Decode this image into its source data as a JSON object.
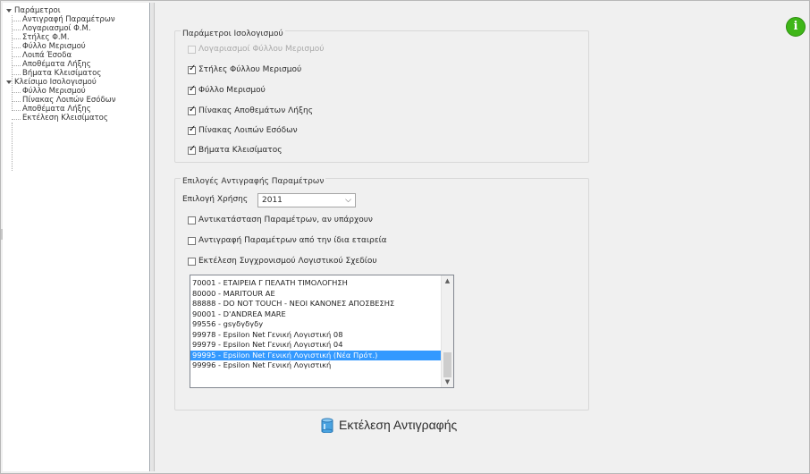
{
  "tree": {
    "nodes": [
      {
        "label": "Παράμετροι",
        "level": 0,
        "expander": true
      },
      {
        "label": "Αντιγραφή Παραμέτρων",
        "level": 1
      },
      {
        "label": "Λογαριασμοί Φ.Μ.",
        "level": 1
      },
      {
        "label": "Στήλες Φ.Μ.",
        "level": 1
      },
      {
        "label": "Φύλλο Μερισμού",
        "level": 1
      },
      {
        "label": "Λοιπά Έσοδα",
        "level": 1
      },
      {
        "label": "Αποθέματα Λήξης",
        "level": 1
      },
      {
        "label": "Βήματα Κλεισίματος",
        "level": 1
      },
      {
        "label": "Κλείσιμο Ισολογισμού",
        "level": 0,
        "expander": true
      },
      {
        "label": "Φύλλο Μερισμού",
        "level": 1
      },
      {
        "label": "Πίνακας Λοιπών Εσόδων",
        "level": 1
      },
      {
        "label": "Αποθέματα Λήξης",
        "level": 1
      },
      {
        "label": "Εκτέλεση Κλεισίματος",
        "level": 1
      }
    ]
  },
  "params_group": {
    "title": "Παράμετροι Ισολογισμού",
    "options": [
      {
        "label": "Λογαριασμοί Φύλλου Μερισμού",
        "checked": false,
        "disabled": true
      },
      {
        "label": "Στήλες Φύλλου Μερισμού",
        "checked": true,
        "disabled": false
      },
      {
        "label": "Φύλλο Μερισμού",
        "checked": true,
        "disabled": false
      },
      {
        "label": "Πίνακας Αποθεμάτων Λήξης",
        "checked": true,
        "disabled": false
      },
      {
        "label": "Πίνακας Λοιπών Εσόδων",
        "checked": true,
        "disabled": false
      },
      {
        "label": "Βήματα Κλεισίματος",
        "checked": true,
        "disabled": false
      }
    ]
  },
  "copy_group": {
    "title": "Επιλογές Αντιγραφής Παραμέτρων",
    "year_label": "Επιλογή Χρήσης",
    "year_value": "2011",
    "options": [
      {
        "label": "Αντικατάσταση Παραμέτρων, αν υπάρχουν",
        "checked": false
      },
      {
        "label": "Αντιγραφή Παραμέτρων από την ίδια εταιρεία",
        "checked": false
      },
      {
        "label": "Εκτέλεση Συγχρονισμού Λογιστικού Σχεδίου",
        "checked": false
      }
    ],
    "companies": [
      {
        "label": "70001 - ΕΤΑΙΡΕΙΑ Γ ΠΕΛΑΤΗ ΤΙΜΟΛΟΓΗΣΗ",
        "selected": false
      },
      {
        "label": "80000 - MARITOUR AE",
        "selected": false
      },
      {
        "label": "88888 - DO NOT TOUCH - ΝΕΟΙ ΚΑΝΟΝΕΣ ΑΠΟΣΒΕΣΗΣ",
        "selected": false
      },
      {
        "label": "90001 - D'ANDREA MARE",
        "selected": false
      },
      {
        "label": "99556 - gsγδγδγδy",
        "selected": false
      },
      {
        "label": "99978 - Epsilon Net Γενική Λογιστική 08",
        "selected": false
      },
      {
        "label": "99979 - Epsilon Net Γενική Λογιστική 04",
        "selected": false
      },
      {
        "label": "99995 - Epsilon Net Γενική Λογιστική (Νέα Πρότ.)",
        "selected": true
      },
      {
        "label": "99996 - Epsilon Net Γενική Λογιστική",
        "selected": false
      }
    ]
  },
  "action": {
    "label": "Εκτέλεση Αντιγραφής",
    "icon": "database-icon"
  },
  "info": {
    "icon": "info-icon",
    "glyph": "i",
    "color": "#3fb618"
  }
}
